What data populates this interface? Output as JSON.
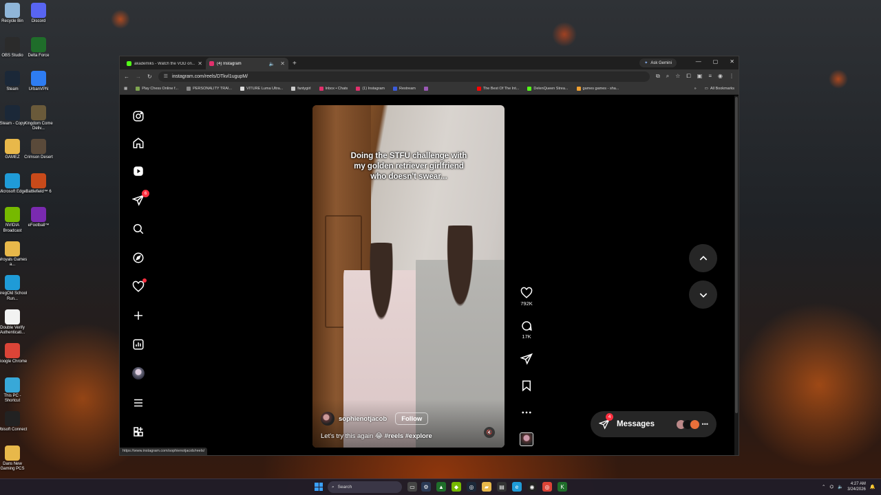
{
  "desktop": {
    "icons": [
      {
        "label": "Recycle Bin",
        "icon": "recycle-bin-icon",
        "color": "#8fb6d9"
      },
      {
        "label": "Discord",
        "icon": "discord-icon",
        "color": "#5865f2"
      },
      {
        "label": "OBS Studio",
        "icon": "obs-icon",
        "color": "#2b2b2b"
      },
      {
        "label": "Delta Force",
        "icon": "delta-force-icon",
        "color": "#1f6d2a"
      },
      {
        "label": "Steam",
        "icon": "steam-icon",
        "color": "#1b2838"
      },
      {
        "label": "UrbanVPN",
        "icon": "urbanvpn-icon",
        "color": "#2e7df2"
      },
      {
        "label": "Steam - Copy",
        "icon": "steam-copy-icon",
        "color": "#1b2838"
      },
      {
        "label": "Kingdom Come Deliv...",
        "icon": "kingdom-come-icon",
        "color": "#6a5a3a"
      },
      {
        "label": "GAMEZ",
        "icon": "folder-icon",
        "color": "#e8b84a"
      },
      {
        "label": "Crimson Desert",
        "icon": "crimson-desert-icon",
        "color": "#5a4a3a"
      },
      {
        "label": "Microsoft Edge",
        "icon": "edge-icon",
        "color": "#1f9bd7"
      },
      {
        "label": "Battlefield™ 6",
        "icon": "battlefield-icon",
        "color": "#c84a1a"
      },
      {
        "label": "NVIDIA Broadcast",
        "icon": "nvidia-broadcast-icon",
        "color": "#76b900"
      },
      {
        "label": "eFootball™",
        "icon": "efootball-icon",
        "color": "#7a2ab0"
      },
      {
        "label": "Wroyals Games a...",
        "icon": "folder-icon",
        "color": "#e8b84a"
      },
      {
        "label": "GregOld School Run...",
        "icon": "edge-icon",
        "color": "#1f9bd7"
      },
      {
        "label": "Double Verify Authenticati...",
        "icon": "document-icon",
        "color": "#f2f2f2"
      },
      {
        "label": "Google Chrome",
        "icon": "chrome-icon",
        "color": "#db4437"
      },
      {
        "label": "This PC - Shortcut",
        "icon": "this-pc-icon",
        "color": "#38a8d8"
      },
      {
        "label": "Ubisoft Connect",
        "icon": "ubisoft-icon",
        "color": "#222"
      },
      {
        "label": "Dans New Gaming PCS",
        "icon": "folder-icon",
        "color": "#e8b84a"
      }
    ]
  },
  "browser": {
    "tabs": [
      {
        "title": "akademiks - Watch the VOD on...",
        "favicon_color": "#53fc18",
        "active": false
      },
      {
        "title": "(4) Instagram",
        "favicon_color": "#e1306c",
        "active": true
      }
    ],
    "new_tab": "+",
    "gemini_label": "Ask Gemini",
    "url": "instagram.com/reels/DTkvl1ugupM/",
    "bookmarks": [
      {
        "label": "Play Chess Online f...",
        "color": "#7fa650"
      },
      {
        "label": "PERSONALITY TRAI...",
        "color": "#888"
      },
      {
        "label": "VITURE Luma Ultra...",
        "color": "#ddd"
      },
      {
        "label": "fantygirl",
        "color": "#ccc"
      },
      {
        "label": "Inbox • Chats",
        "color": "#e1306c"
      },
      {
        "label": "(1) Instagram",
        "color": "#e1306c"
      },
      {
        "label": "Restream",
        "color": "#3b5bdb"
      },
      {
        "label": "",
        "color": "#9b59b6"
      },
      {
        "label": "The Best Of The Int...",
        "color": "#ff0000"
      },
      {
        "label": "DelenQueen Strea...",
        "color": "#53fc18"
      },
      {
        "label": "games games - sha...",
        "color": "#f0a030"
      }
    ],
    "all_bookmarks": "All Bookmarks",
    "status_url": "https://www.instagram.com/sophienotjacob/reels/"
  },
  "instagram": {
    "nav_badge_reels": "6",
    "reel": {
      "caption": "Doing the STFU challenge with my golden retriever girlfriend who doesn't swear...",
      "username": "sophienotjacob",
      "follow_label": "Follow",
      "description": "Let's try this again 😂",
      "hashtags": "#reels #explore"
    },
    "actions": {
      "likes": "792K",
      "comments": "17K"
    },
    "messages": {
      "label": "Messages",
      "badge": "4"
    }
  },
  "taskbar": {
    "search_placeholder": "Search",
    "time": "4:27 AM",
    "date": "3/24/2026"
  }
}
